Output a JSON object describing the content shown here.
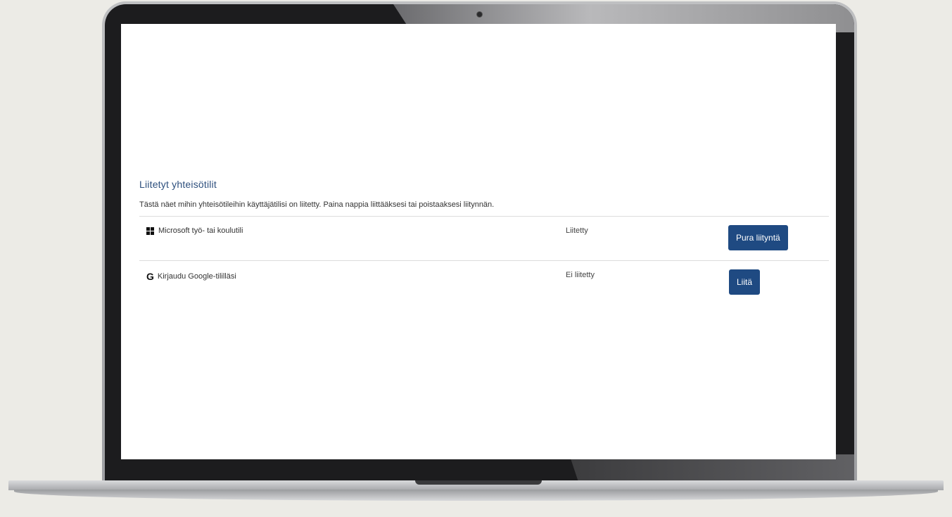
{
  "section": {
    "title": "Liitetyt yhteisötilit",
    "description": "Tästä näet mihin yhteisötileihin käyttäjätilisi on liitetty. Paina nappia liittääksesi tai poistaaksesi liitynnän."
  },
  "accounts": [
    {
      "provider": "Microsoft työ- tai koulutili",
      "icon": "windows-icon",
      "status": "Liitetty",
      "action": "Pura liityntä"
    },
    {
      "provider": "Kirjaudu Google-tililläsi",
      "icon": "google-icon",
      "icon_glyph": "G",
      "status": "Ei liitetty",
      "action": "Liitä"
    }
  ],
  "colors": {
    "accent": "#1f4a82",
    "title": "#2d4f7d"
  }
}
